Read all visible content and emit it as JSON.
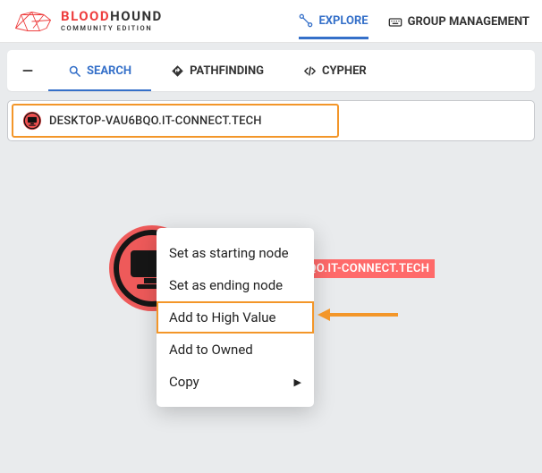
{
  "brand": {
    "name_a": "BLOOD",
    "name_b": "HOUND",
    "subtitle": "COMMUNITY EDITION"
  },
  "nav": {
    "explore": "EXPLORE",
    "group_mgmt": "GROUP MANAGEMENT"
  },
  "tabs": {
    "search": "SEARCH",
    "pathfinding": "PATHFINDING",
    "cypher": "CYPHER"
  },
  "search": {
    "selected_node": "DESKTOP-VAU6BQO.IT-CONNECT.TECH"
  },
  "graph": {
    "node_label": "DESKTOP-VAU6BQO.IT-CONNECT.TECH"
  },
  "context_menu": {
    "start": "Set as starting node",
    "end": "Set as ending node",
    "high_value": "Add to High Value",
    "owned": "Add to Owned",
    "copy": "Copy"
  }
}
